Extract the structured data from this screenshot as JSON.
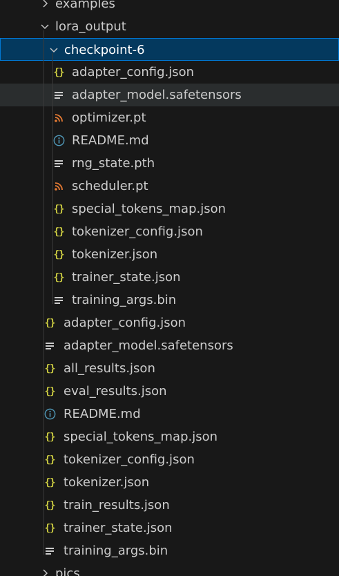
{
  "colors": {
    "background": "#181818",
    "selected_bg": "#04395e",
    "selected_border": "#0078d4",
    "hover_bg": "#2a2d2e",
    "json_icon": "#cbcb41",
    "rss_icon": "#e37933",
    "info_icon": "#519aba",
    "text": "#cccccc"
  },
  "tree": [
    {
      "label": "examples",
      "kind": "folder",
      "state": "collapsed",
      "depth": 1
    },
    {
      "label": "lora_output",
      "kind": "folder",
      "state": "expanded",
      "depth": 1
    },
    {
      "label": "checkpoint-6",
      "kind": "folder",
      "state": "expanded",
      "depth": 2,
      "selected": true
    },
    {
      "label": "adapter_config.json",
      "kind": "file",
      "icon": "json-braces-icon",
      "depth": 3
    },
    {
      "label": "adapter_model.safetensors",
      "kind": "file",
      "icon": "lines-icon",
      "depth": 3,
      "hovered": true
    },
    {
      "label": "optimizer.pt",
      "kind": "file",
      "icon": "rss-icon",
      "depth": 3
    },
    {
      "label": "README.md",
      "kind": "file",
      "icon": "info-icon",
      "depth": 3
    },
    {
      "label": "rng_state.pth",
      "kind": "file",
      "icon": "lines-icon",
      "depth": 3
    },
    {
      "label": "scheduler.pt",
      "kind": "file",
      "icon": "rss-icon",
      "depth": 3
    },
    {
      "label": "special_tokens_map.json",
      "kind": "file",
      "icon": "json-braces-icon",
      "depth": 3
    },
    {
      "label": "tokenizer_config.json",
      "kind": "file",
      "icon": "json-braces-icon",
      "depth": 3
    },
    {
      "label": "tokenizer.json",
      "kind": "file",
      "icon": "json-braces-icon",
      "depth": 3
    },
    {
      "label": "trainer_state.json",
      "kind": "file",
      "icon": "json-braces-icon",
      "depth": 3
    },
    {
      "label": "training_args.bin",
      "kind": "file",
      "icon": "lines-icon",
      "depth": 3
    },
    {
      "label": "adapter_config.json",
      "kind": "file",
      "icon": "json-braces-icon",
      "depth": 2
    },
    {
      "label": "adapter_model.safetensors",
      "kind": "file",
      "icon": "lines-icon",
      "depth": 2
    },
    {
      "label": "all_results.json",
      "kind": "file",
      "icon": "json-braces-icon",
      "depth": 2
    },
    {
      "label": "eval_results.json",
      "kind": "file",
      "icon": "json-braces-icon",
      "depth": 2
    },
    {
      "label": "README.md",
      "kind": "file",
      "icon": "info-icon",
      "depth": 2
    },
    {
      "label": "special_tokens_map.json",
      "kind": "file",
      "icon": "json-braces-icon",
      "depth": 2
    },
    {
      "label": "tokenizer_config.json",
      "kind": "file",
      "icon": "json-braces-icon",
      "depth": 2
    },
    {
      "label": "tokenizer.json",
      "kind": "file",
      "icon": "json-braces-icon",
      "depth": 2
    },
    {
      "label": "train_results.json",
      "kind": "file",
      "icon": "json-braces-icon",
      "depth": 2
    },
    {
      "label": "trainer_state.json",
      "kind": "file",
      "icon": "json-braces-icon",
      "depth": 2
    },
    {
      "label": "training_args.bin",
      "kind": "file",
      "icon": "lines-icon",
      "depth": 2
    },
    {
      "label": "pics",
      "kind": "folder",
      "state": "collapsed",
      "depth": 1
    }
  ]
}
